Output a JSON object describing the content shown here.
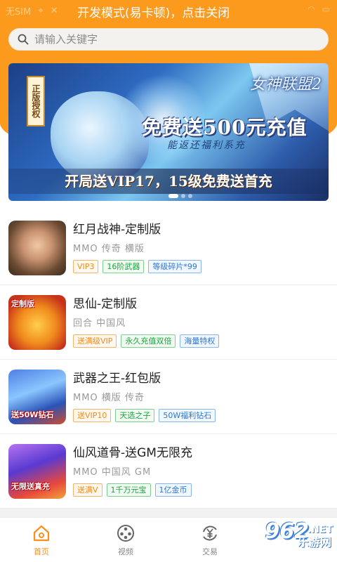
{
  "status_bar": {
    "sim": "无SIM",
    "message": "开发模式(易卡顿)，点击关闭"
  },
  "search": {
    "placeholder": "请输入关键字"
  },
  "banner": {
    "seal_text": "正版授权",
    "game_logo": "女神联盟2",
    "headline": "免费送500元充值",
    "subline": "能返还福利系充",
    "strip": "开局送VIP17，15级免费送首充"
  },
  "games": [
    {
      "title": "红月战神-定制版",
      "sub": "MMO 传奇 横版",
      "tags": [
        "VIP3",
        "16阶武器",
        "等级碎片*99"
      ],
      "thumb_label": ""
    },
    {
      "title": "思仙-定制版",
      "sub": "回合 中国风",
      "tags": [
        "送满级VIP",
        "永久充值双倍",
        "海量特权"
      ],
      "thumb_label": "定制版"
    },
    {
      "title": "武器之王-红包版",
      "sub": "MMO 横版 传奇",
      "tags": [
        "送VIP10",
        "天选之子",
        "50W福利钻石"
      ],
      "thumb_label": "送50W钻石"
    },
    {
      "title": "仙风道骨-送GM无限充",
      "sub": "MMO 中国风 GM",
      "tags": [
        "送满V",
        "1千万元宝",
        "1亿金币"
      ],
      "thumb_label": "无限送真充"
    }
  ],
  "nav": {
    "home": "首页",
    "video": "视频",
    "trade": "交易"
  },
  "watermark": {
    "num": "962",
    "net": ".NET",
    "cn": "乐游网"
  },
  "colors": {
    "accent": "#fc9a1e",
    "tag_orange": "#f5891a",
    "tag_green": "#1aa63c",
    "tag_blue": "#2e78d2"
  }
}
